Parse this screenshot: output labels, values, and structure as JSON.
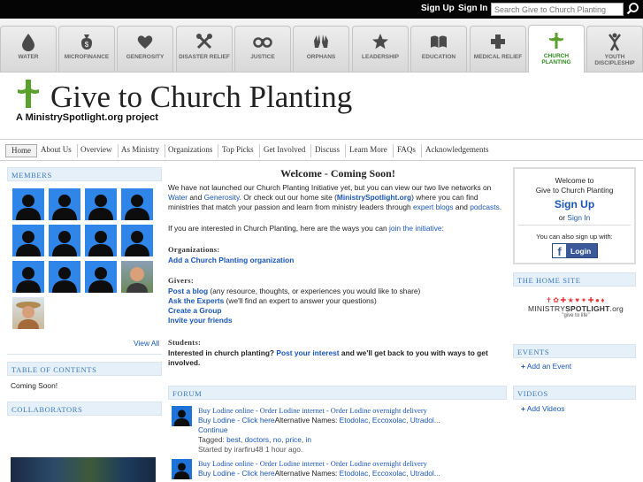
{
  "topbar": {
    "signup": "Sign Up",
    "signin": "Sign In",
    "search_placeholder": "Search Give to Church Planting"
  },
  "causes": [
    {
      "label": "WATER",
      "icon": "water-drop-icon"
    },
    {
      "label": "MICROFINANCE",
      "icon": "money-bag-icon"
    },
    {
      "label": "GENEROSITY",
      "icon": "heart-icon"
    },
    {
      "label": "DISASTER RELIEF",
      "icon": "crossed-tools-icon"
    },
    {
      "label": "JUSTICE",
      "icon": "handcuffs-icon"
    },
    {
      "label": "ORPHANS",
      "icon": "hands-icon"
    },
    {
      "label": "LEADERSHIP",
      "icon": "star-icon"
    },
    {
      "label": "EDUCATION",
      "icon": "book-icon"
    },
    {
      "label": "MEDICAL RELIEF",
      "icon": "medical-cross-icon"
    },
    {
      "label": "CHURCH PLANTING",
      "icon": "church-cross-icon"
    },
    {
      "label": "YOUTH DISCIPLESHIP",
      "icon": "youth-figure-icon"
    }
  ],
  "header": {
    "title": "Give to Church Planting",
    "subtitle": "A MinistrySpotlight.org project"
  },
  "nav": [
    "Home",
    "About Us",
    "Overview",
    "As Ministry",
    "Organizations",
    "Top Picks",
    "Get Involved",
    "Discuss",
    "Learn More",
    "FAQs",
    "Acknowledgements"
  ],
  "members": {
    "heading": "MEMBERS",
    "view_all": "View All"
  },
  "toc": {
    "heading": "TABLE OF CONTENTS",
    "text": "Coming Soon!"
  },
  "collaborators": {
    "heading": "COLLABORATORS"
  },
  "main": {
    "welcome": "Welcome - Coming Soon!",
    "p1": [
      "We have not launched our Church Planting Initiative yet, but you can view our two live networks on ",
      "Water",
      " and ",
      "Generosity",
      ". Or check out our home site (",
      "MinistrySpotlight.org",
      ") where you can find ministries that match your passion and learn from ministry leaders through ",
      "expert blogs",
      " and ",
      "podcasts",
      "."
    ],
    "p2": [
      "If you are interested in Church Planting, here are the ways you can ",
      "join the initiative",
      ":"
    ],
    "org_heading": "Organizations:",
    "org_link": "Add a Church Planting organization",
    "givers_heading": "Givers:",
    "givers": [
      {
        "link": "Post a blog",
        "rest": " (any resource, thoughts, or experiences you would like to share)"
      },
      {
        "link": "Ask the Experts",
        "rest": " (we'll find an expert to answer your questions)"
      },
      {
        "link": "Create a Group",
        "rest": ""
      },
      {
        "link": "Invite your friends",
        "rest": ""
      }
    ],
    "students_heading": "Students:",
    "students": [
      "Interested in church planting? ",
      "Post your interest",
      " and we'll get back to you with ways to get involved."
    ]
  },
  "forum": {
    "heading": "FORUM",
    "posts": [
      {
        "title": "Buy Lodine online - Order Lodine internet - Order Lodine overnight delivery",
        "line2a": "Buy Lodine - Click here",
        "line2b": "Alternative Names: ",
        "line2c": "Etodolac, Eccoxolac, Utradol...",
        "cont": "Continue",
        "tagged": "Tagged: ",
        "tags": [
          "best",
          "doctors",
          "no",
          "price",
          "in"
        ],
        "started": "Started by irarfiru48 1 hour ago."
      },
      {
        "title": "Buy Lodine online - Order Lodine internet - Order Lodine overnight delivery",
        "line2a": "Buy Lodine - Click here",
        "line2b": "Alternative Names: ",
        "line2c": "Etodolac, Eccoxolac, Utradol..."
      }
    ]
  },
  "right": {
    "welcome1": "Welcome to",
    "welcome2": "Give to Church Planting",
    "signup": "Sign Up",
    "or": "or",
    "signin": "Sign In",
    "also": "You can also sign up with:",
    "fb_login": "Login",
    "home_heading": "THE HOME SITE",
    "home_logo_a": "MINISTRY",
    "home_logo_b": "SPOTLIGHT",
    "home_logo_c": ".org",
    "home_tagline": "\"give to life\"",
    "events_heading": "EVENTS",
    "events_link": "Add an Event",
    "videos_heading": "VIDEOS",
    "videos_link": "Add Videos"
  },
  "colors": {
    "accent_green": "#5aa02c",
    "link_blue": "#1a56b8",
    "header_blue": "#3a78b8",
    "avatar_blue": "#2f86e8"
  }
}
